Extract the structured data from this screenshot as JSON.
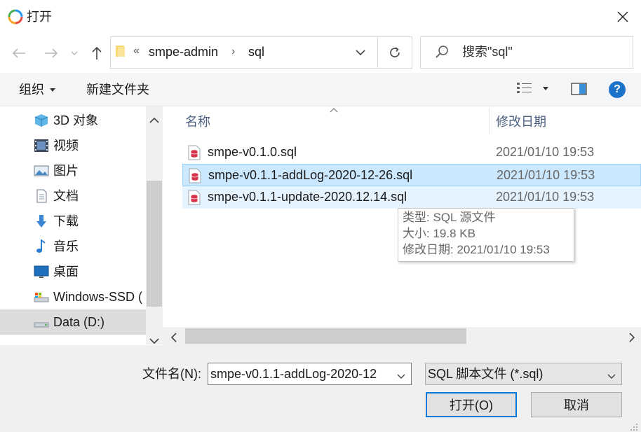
{
  "window": {
    "title": "打开",
    "app_icon": "colorful-ring-app-icon",
    "close_icon": "close-icon"
  },
  "address": {
    "overflow_glyph": "«",
    "crumbs": [
      "smpe-admin",
      "sql"
    ],
    "separator": "›",
    "search_placeholder": "搜索\"sql\""
  },
  "toolbar": {
    "organize_label": "组织",
    "new_folder_label": "新建文件夹"
  },
  "nav": {
    "items": [
      {
        "label": "3D 对象",
        "icon": "3d-objects-icon"
      },
      {
        "label": "视频",
        "icon": "video-icon"
      },
      {
        "label": "图片",
        "icon": "pictures-icon"
      },
      {
        "label": "文档",
        "icon": "documents-icon"
      },
      {
        "label": "下载",
        "icon": "download-icon"
      },
      {
        "label": "音乐",
        "icon": "music-icon"
      },
      {
        "label": "桌面",
        "icon": "desktop-icon"
      },
      {
        "label": "Windows-SSD (",
        "icon": "drive-icon"
      },
      {
        "label": "Data (D:)",
        "icon": "drive-icon",
        "selected": true
      }
    ]
  },
  "columns": {
    "name": "名称",
    "date_modified": "修改日期"
  },
  "files": [
    {
      "name": "smpe-v0.1.0.sql",
      "date": "2021/01/10 19:53",
      "state": "normal"
    },
    {
      "name": "smpe-v0.1.1-addLog-2020-12-26.sql",
      "date": "2021/01/10 19:53",
      "state": "selected"
    },
    {
      "name": "smpe-v0.1.1-update-2020.12.14.sql",
      "date": "2021/01/10 19:53",
      "state": "hover"
    }
  ],
  "tooltip": {
    "type_line": "类型: SQL 源文件",
    "size_line": "大小: 19.8 KB",
    "date_line": "修改日期: 2021/01/10 19:53"
  },
  "bottom": {
    "filename_label": "文件名(N):",
    "filename_value": "smpe-v0.1.1-addLog-2020-12",
    "filetype_value": "SQL 脚本文件 (*.sql)",
    "open_label": "打开(O)",
    "cancel_label": "取消"
  },
  "colors": {
    "selected_row": "#cce8ff",
    "hover_row": "#e5f3ff",
    "accent": "#0078d7",
    "help": "#1a73c9"
  }
}
